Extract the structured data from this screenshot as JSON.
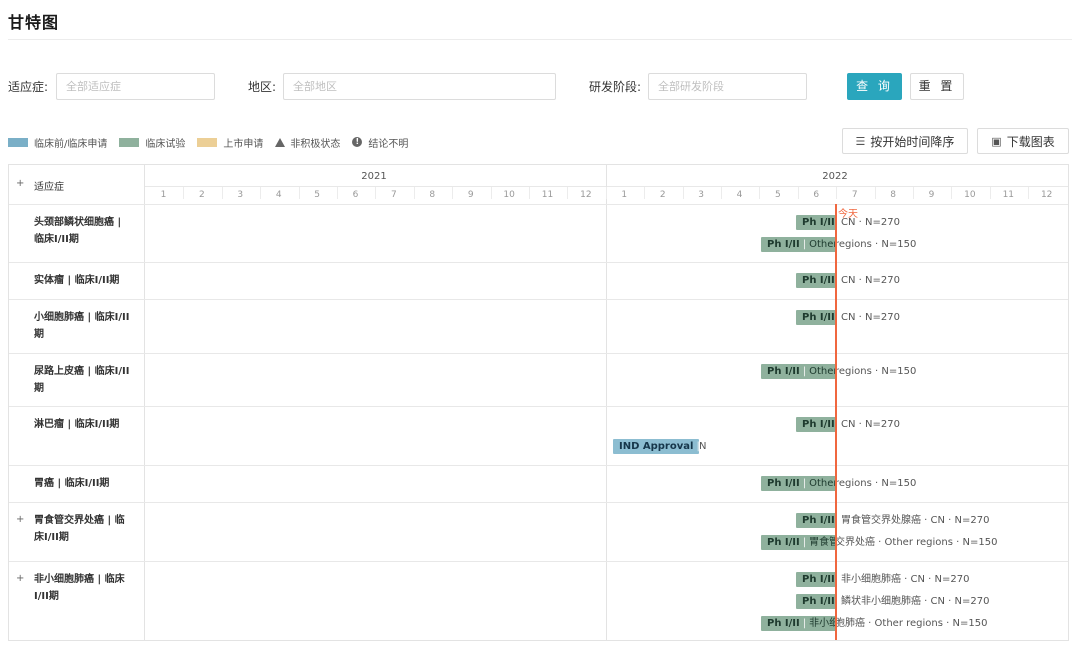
{
  "page_title": "甘特图",
  "filters": {
    "indication": {
      "label": "适应症:",
      "placeholder": "全部适应症"
    },
    "region": {
      "label": "地区:",
      "placeholder": "全部地区"
    },
    "phase": {
      "label": "研发阶段:",
      "placeholder": "全部研发阶段"
    },
    "query_button": "查 询",
    "reset_button": "重 置"
  },
  "legend": [
    {
      "label": "临床前/临床申请",
      "color": "#7aafc7",
      "kind": "swatch"
    },
    {
      "label": "临床试验",
      "color": "#8fb19d",
      "kind": "swatch"
    },
    {
      "label": "上市申请",
      "color": "#eccf96",
      "kind": "swatch"
    },
    {
      "label": "非积极状态",
      "kind": "triangle"
    },
    {
      "label": "结论不明",
      "kind": "info"
    }
  ],
  "toolbar": {
    "sort_label": "按开始时间降序",
    "sort_icon": "sort-list-icon",
    "download_label": "下载图表",
    "download_icon": "download-chart-icon"
  },
  "gantt": {
    "header_label": "适应症",
    "years": [
      "2021",
      "2022"
    ],
    "months": [
      "1",
      "2",
      "3",
      "4",
      "5",
      "6",
      "7",
      "8",
      "9",
      "10",
      "11",
      "12"
    ],
    "today_label": "今天",
    "rows": [
      {
        "label": "头颈部鳞状细胞癌 | 临床I/II期",
        "expandable": false,
        "bars": [
          {
            "phase": "Ph I/II",
            "note": "CN · N=270",
            "type": "trial"
          },
          {
            "phase": "Ph I/II",
            "inline": "Other",
            "note": "regions · N=150",
            "type": "trial"
          }
        ]
      },
      {
        "label": "实体瘤 | 临床I/II期",
        "expandable": false,
        "bars": [
          {
            "phase": "Ph I/II",
            "note": "CN · N=270",
            "type": "trial"
          }
        ]
      },
      {
        "label": "小细胞肺癌 | 临床I/II期",
        "expandable": false,
        "bars": [
          {
            "phase": "Ph I/II",
            "note": "CN · N=270",
            "type": "trial"
          }
        ]
      },
      {
        "label": "尿路上皮癌 | 临床I/II期",
        "expandable": false,
        "bars": [
          {
            "phase": "Ph I/II",
            "inline": "Other",
            "note": "regions · N=150",
            "type": "trial"
          }
        ]
      },
      {
        "label": "淋巴瘤 | 临床I/II期",
        "expandable": false,
        "bars": [
          {
            "phase": "Ph I/II",
            "note": "CN · N=270",
            "type": "trial"
          },
          {
            "phase": "IND Approval",
            "inline": "C",
            "note": "N",
            "type": "preclinical"
          }
        ]
      },
      {
        "label": "胃癌 | 临床I/II期",
        "expandable": false,
        "bars": [
          {
            "phase": "Ph I/II",
            "inline": "Other",
            "note": "regions · N=150",
            "type": "trial"
          }
        ]
      },
      {
        "label": "胃食管交界处癌 | 临床I/II期",
        "expandable": true,
        "bars": [
          {
            "phase": "Ph I/II",
            "note": "胃食管交界处腺癌 · CN · N=270",
            "type": "trial"
          },
          {
            "phase": "Ph I/II",
            "inline": "胃食管",
            "note": "交界处癌 · Other regions · N=150",
            "type": "trial"
          }
        ]
      },
      {
        "label": "非小细胞肺癌 | 临床I/II期",
        "expandable": true,
        "bars": [
          {
            "phase": "Ph I/II",
            "note": "非小细胞肺癌 · CN · N=270",
            "type": "trial"
          },
          {
            "phase": "Ph I/II",
            "note": "鳞状非小细胞肺癌 · CN · N=270",
            "type": "trial"
          },
          {
            "phase": "Ph I/II",
            "inline": "非小细",
            "note": "胞肺癌 · Other regions · N=150",
            "type": "trial"
          }
        ]
      }
    ]
  }
}
